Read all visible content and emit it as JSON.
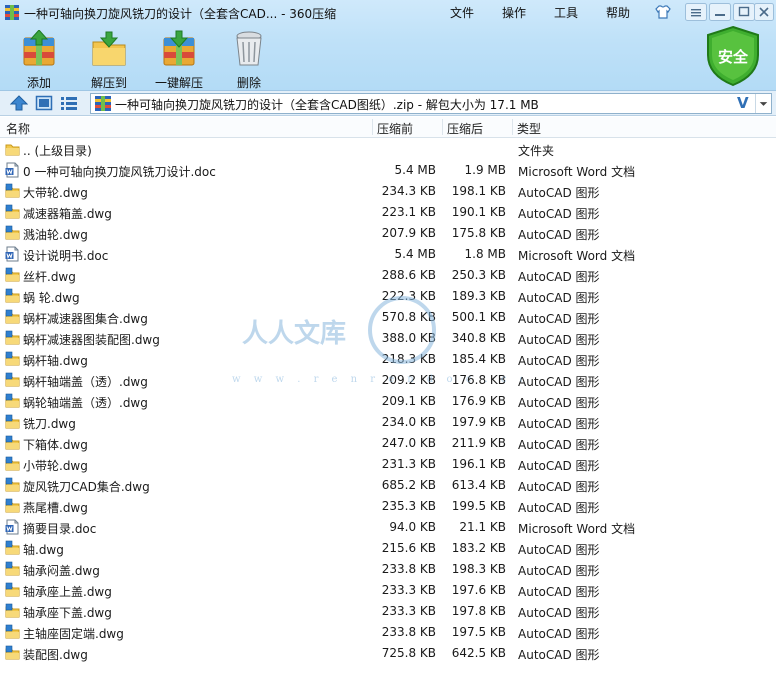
{
  "window": {
    "title": "一种可轴向换刀旋风铣刀的设计（全套含CAD... - 360压缩",
    "menu": [
      "文件",
      "操作",
      "工具",
      "帮助"
    ]
  },
  "toolbar": {
    "add": "添加",
    "extract_to": "解压到",
    "one_click": "一键解压",
    "delete": "删除"
  },
  "security_badge": "安全",
  "address": {
    "text": "一种可轴向换刀旋风铣刀的设计（全套含CAD图纸）.zip - 解包大小为 17.1 MB",
    "v_label": "V"
  },
  "columns": {
    "name": "名称",
    "before": "压缩前",
    "after": "压缩后",
    "type": "类型"
  },
  "files": [
    {
      "name": ".. (上级目录)",
      "before": "",
      "after": "",
      "type": "文件夹",
      "icon": "folder-icon"
    },
    {
      "name": "0 一种可轴向换刀旋风铣刀设计.doc",
      "before": "5.4 MB",
      "after": "1.9 MB",
      "type": "Microsoft Word 文档",
      "icon": "word-doc-icon"
    },
    {
      "name": "大带轮.dwg",
      "before": "234.3 KB",
      "after": "198.1 KB",
      "type": "AutoCAD 图形",
      "icon": "dwg-file-icon"
    },
    {
      "name": "减速器箱盖.dwg",
      "before": "223.1 KB",
      "after": "190.1 KB",
      "type": "AutoCAD 图形",
      "icon": "dwg-file-icon"
    },
    {
      "name": "溅油轮.dwg",
      "before": "207.9 KB",
      "after": "175.8 KB",
      "type": "AutoCAD 图形",
      "icon": "dwg-file-icon"
    },
    {
      "name": "设计说明书.doc",
      "before": "5.4 MB",
      "after": "1.8 MB",
      "type": "Microsoft Word 文档",
      "icon": "word-doc-icon"
    },
    {
      "name": "丝杆.dwg",
      "before": "288.6 KB",
      "after": "250.3 KB",
      "type": "AutoCAD 图形",
      "icon": "dwg-file-icon"
    },
    {
      "name": "蜗 轮.dwg",
      "before": "222.3 KB",
      "after": "189.3 KB",
      "type": "AutoCAD 图形",
      "icon": "dwg-file-icon"
    },
    {
      "name": "蜗杆减速器图集合.dwg",
      "before": "570.8 KB",
      "after": "500.1 KB",
      "type": "AutoCAD 图形",
      "icon": "dwg-file-icon"
    },
    {
      "name": "蜗杆减速器图装配图.dwg",
      "before": "388.0 KB",
      "after": "340.8 KB",
      "type": "AutoCAD 图形",
      "icon": "dwg-file-icon"
    },
    {
      "name": "蜗杆轴.dwg",
      "before": "218.3 KB",
      "after": "185.4 KB",
      "type": "AutoCAD 图形",
      "icon": "dwg-file-icon"
    },
    {
      "name": "蜗杆轴端盖（透）.dwg",
      "before": "209.2 KB",
      "after": "176.8 KB",
      "type": "AutoCAD 图形",
      "icon": "dwg-file-icon"
    },
    {
      "name": "蜗轮轴端盖（透）.dwg",
      "before": "209.1 KB",
      "after": "176.9 KB",
      "type": "AutoCAD 图形",
      "icon": "dwg-file-icon"
    },
    {
      "name": "铣刀.dwg",
      "before": "234.0 KB",
      "after": "197.9 KB",
      "type": "AutoCAD 图形",
      "icon": "dwg-file-icon"
    },
    {
      "name": "下箱体.dwg",
      "before": "247.0 KB",
      "after": "211.9 KB",
      "type": "AutoCAD 图形",
      "icon": "dwg-file-icon"
    },
    {
      "name": "小带轮.dwg",
      "before": "231.3 KB",
      "after": "196.1 KB",
      "type": "AutoCAD 图形",
      "icon": "dwg-file-icon"
    },
    {
      "name": "旋风铣刀CAD集合.dwg",
      "before": "685.2 KB",
      "after": "613.4 KB",
      "type": "AutoCAD 图形",
      "icon": "dwg-file-icon"
    },
    {
      "name": "燕尾槽.dwg",
      "before": "235.3 KB",
      "after": "199.5 KB",
      "type": "AutoCAD 图形",
      "icon": "dwg-file-icon"
    },
    {
      "name": "摘要目录.doc",
      "before": "94.0 KB",
      "after": "21.1 KB",
      "type": "Microsoft Word 文档",
      "icon": "word-doc-icon"
    },
    {
      "name": "轴.dwg",
      "before": "215.6 KB",
      "after": "183.2 KB",
      "type": "AutoCAD 图形",
      "icon": "dwg-file-icon"
    },
    {
      "name": "轴承闷盖.dwg",
      "before": "233.8 KB",
      "after": "198.3 KB",
      "type": "AutoCAD 图形",
      "icon": "dwg-file-icon"
    },
    {
      "name": "轴承座上盖.dwg",
      "before": "233.3 KB",
      "after": "197.6 KB",
      "type": "AutoCAD 图形",
      "icon": "dwg-file-icon"
    },
    {
      "name": "轴承座下盖.dwg",
      "before": "233.3 KB",
      "after": "197.8 KB",
      "type": "AutoCAD 图形",
      "icon": "dwg-file-icon"
    },
    {
      "name": "主轴座固定端.dwg",
      "before": "233.8 KB",
      "after": "197.5 KB",
      "type": "AutoCAD 图形",
      "icon": "dwg-file-icon"
    },
    {
      "name": "装配图.dwg",
      "before": "725.8 KB",
      "after": "642.5 KB",
      "type": "AutoCAD 图形",
      "icon": "dwg-file-icon"
    }
  ],
  "watermark": {
    "text": "人人文库",
    "url": "w w w . r e n r e n d o c . c o m"
  }
}
